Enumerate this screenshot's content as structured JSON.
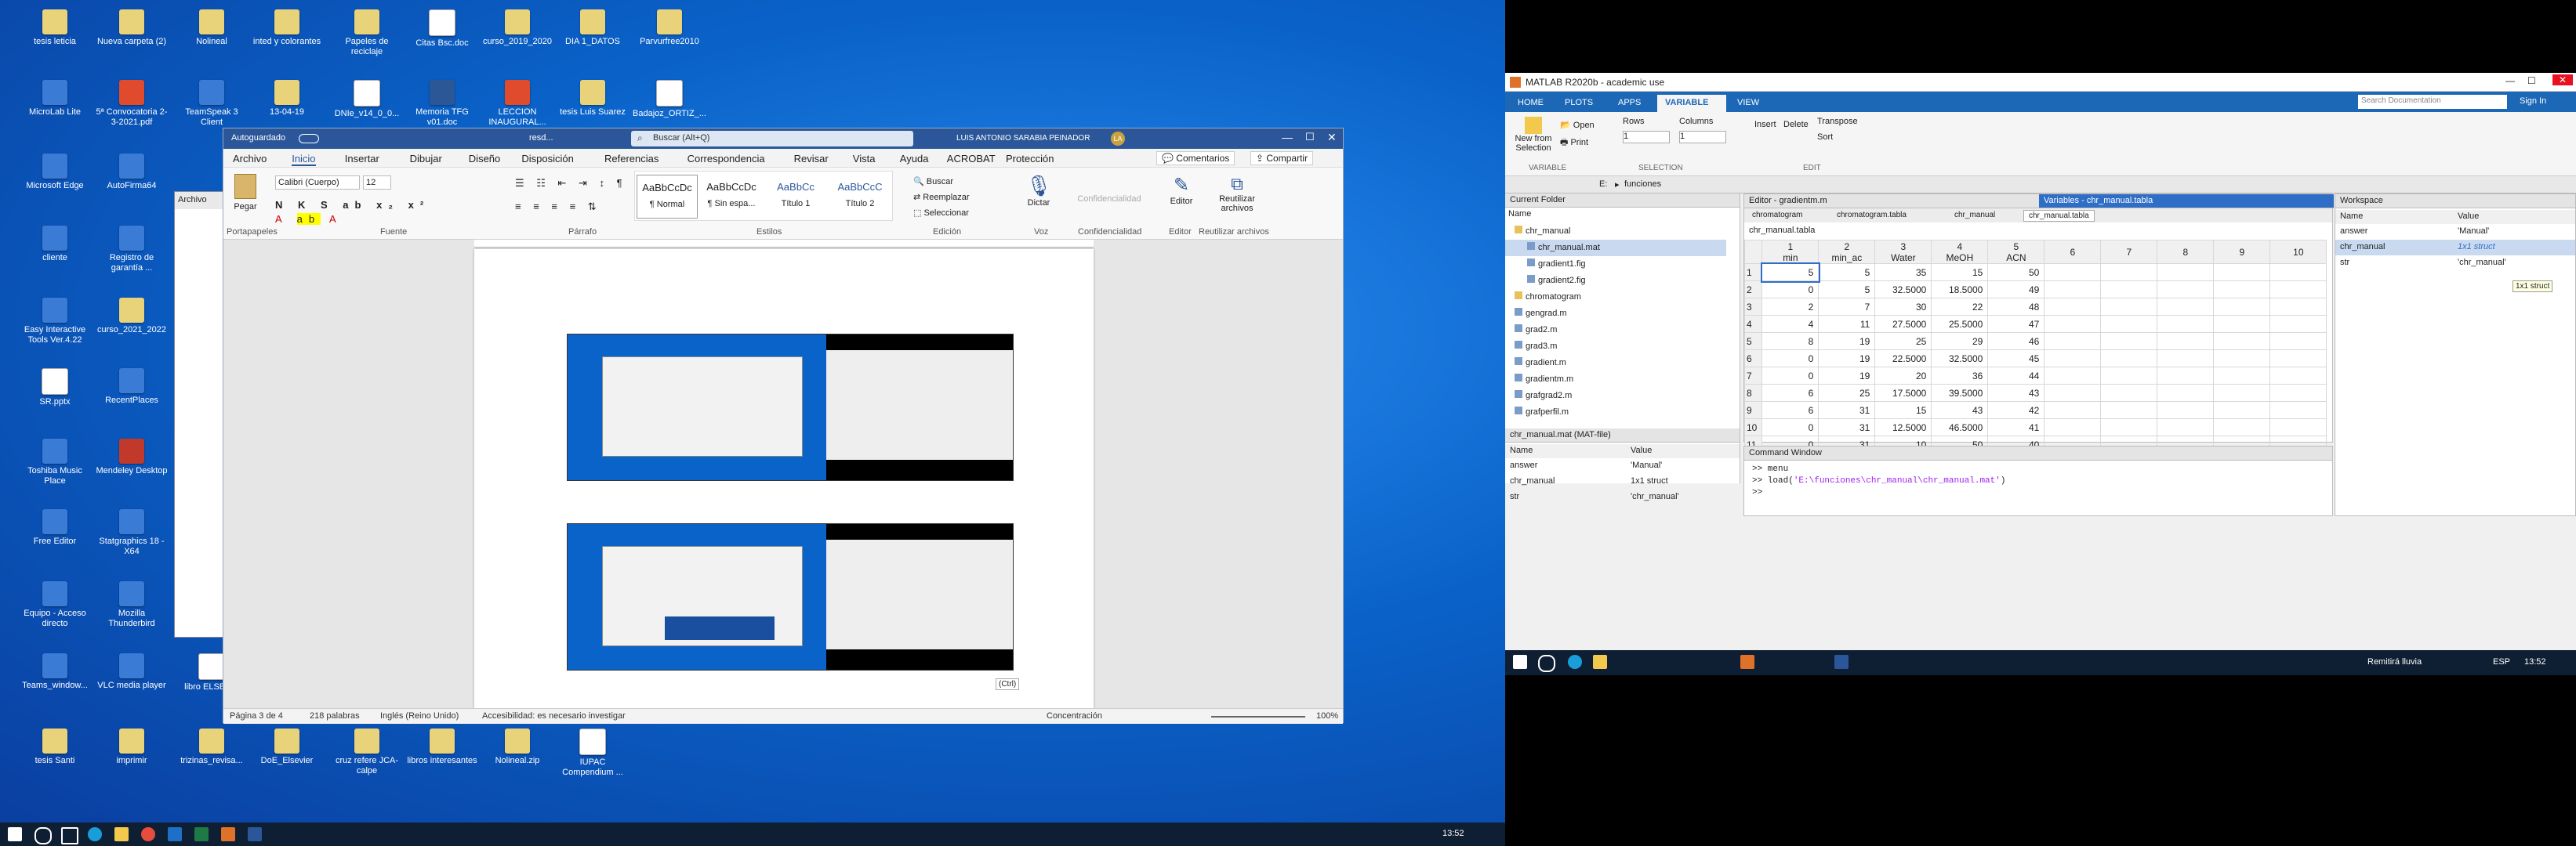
{
  "desktop_icons": [
    {
      "label": "tesis leticia",
      "type": "folder"
    },
    {
      "label": "Nueva carpeta (2)",
      "type": "folder"
    },
    {
      "label": "Nolineal",
      "type": "folder"
    },
    {
      "label": "inted y colorantes",
      "type": "folder"
    },
    {
      "label": "Papeles de reciclaje",
      "type": "folder"
    },
    {
      "label": "Citas Bsc.doc",
      "type": "doc"
    },
    {
      "label": "curso_2019_2020",
      "type": "folder"
    },
    {
      "label": "DIA 1_DATOS",
      "type": "folder"
    },
    {
      "label": "Parvurfree2010",
      "type": "folder"
    },
    {
      "label": "MicroLab Lite",
      "type": "app"
    },
    {
      "label": "5ª Convocatoria 2-3-2021.pdf",
      "type": "pdf"
    },
    {
      "label": "TeamSpeak 3 Client",
      "type": "app"
    },
    {
      "label": "13-04-19",
      "type": "folder"
    },
    {
      "label": "DNIe_v14_0_0...",
      "type": "doc"
    },
    {
      "label": "Memoria TFG v01.doc",
      "type": "word"
    },
    {
      "label": "LECCION INAUGURAL...",
      "type": "pdf"
    },
    {
      "label": "tesis Luis Suarez",
      "type": "folder"
    },
    {
      "label": "Badajoz_ORTIZ_...",
      "type": "doc"
    },
    {
      "label": "Microsoft Edge",
      "type": "app"
    },
    {
      "label": "AutoFirma64",
      "type": "app"
    },
    {
      "label": "cliente",
      "type": "app"
    },
    {
      "label": "Registro de garantía ...",
      "type": "app"
    },
    {
      "label": "Easy Interactive Tools Ver.4.22",
      "type": "app"
    },
    {
      "label": "curso_2021_2022",
      "type": "folder"
    },
    {
      "label": "SR.pptx",
      "type": "doc"
    },
    {
      "label": "RecentPlaces",
      "type": "app"
    },
    {
      "label": "Toshiba Music Place",
      "type": "app"
    },
    {
      "label": "Mendeley Desktop",
      "type": "red"
    },
    {
      "label": "Free Editor",
      "type": "app"
    },
    {
      "label": "Statgraphics 18 - X64",
      "type": "app"
    },
    {
      "label": "Equipo - Acceso directo",
      "type": "app"
    },
    {
      "label": "Mozilla Thunderbird",
      "type": "app"
    },
    {
      "label": "Teams_window...",
      "type": "app"
    },
    {
      "label": "VLC media player",
      "type": "app"
    },
    {
      "label": "libro ELSEVIE",
      "type": "doc"
    },
    {
      "label": "tesis Santi",
      "type": "folder"
    },
    {
      "label": "imprimir",
      "type": "folder"
    },
    {
      "label": "trizinas_revisa...",
      "type": "folder"
    },
    {
      "label": "DoE_Elsevier",
      "type": "folder"
    },
    {
      "label": "cruz refere JCA-calpe",
      "type": "folder"
    },
    {
      "label": "libros interesantes",
      "type": "folder"
    },
    {
      "label": "Nolineal.zip",
      "type": "folder"
    },
    {
      "label": "IUPAC Compendium ...",
      "type": "doc"
    }
  ],
  "taskbar1": {
    "time": "13:52"
  },
  "word": {
    "autosave": "Autoguardado",
    "doc_name": "resd... ",
    "search_placeholder": "Buscar (Alt+Q)",
    "user": "LUIS ANTONIO SARABIA PEINADOR",
    "user_initials": "LA",
    "menu": [
      "Archivo",
      "Inicio",
      "Insertar",
      "Dibujar",
      "Diseño",
      "Disposición",
      "Referencias",
      "Correspondencia",
      "Revisar",
      "Vista",
      "Ayuda",
      "ACROBAT",
      "Protección"
    ],
    "comments": "Comentarios",
    "share": "Compartir",
    "ribbon": {
      "paste": "Pegar",
      "clipboard": "Portapapeles",
      "font_name": "Calibri (Cuerpo)",
      "font_size": "12",
      "font_group": "Fuente",
      "paragraph_group": "Párrafo",
      "styles": [
        "AaBbCcDc",
        "AaBbCcDc",
        "AaBbCc",
        "AaBbCcC"
      ],
      "style_names": [
        "¶ Normal",
        "¶ Sin espa...",
        "Título 1",
        "Título 2"
      ],
      "styles_group": "Estilos",
      "find": "Buscar",
      "replace": "Reemplazar",
      "select": "Seleccionar",
      "edit_group": "Edición",
      "dictate": "Dictar",
      "voice_group": "Voz",
      "sensitivity": "Confidencialidad",
      "editor": "Editor",
      "reuse": "Reutilizar archivos"
    },
    "ctrl_tag": "(Ctrl)",
    "status": {
      "page": "Página 3 de 4",
      "words": "218 palabras",
      "language": "Inglés (Reino Unido)",
      "accessibility": "Accesibilidad: es necesario investigar",
      "focus": "Concentración",
      "zoom": "100%"
    }
  },
  "matlab": {
    "title": "MATLAB R2020b - academic use",
    "tabs": [
      "HOME",
      "PLOTS",
      "APPS",
      "VARIABLE",
      "VIEW"
    ],
    "search_placeholder": "Search Documentation",
    "sign_in": "Sign In",
    "toolstrip": {
      "new_from_selection": "New from Selection",
      "open": "Open",
      "print": "Print",
      "rows": "Rows",
      "columns": "Columns",
      "rows_val": "1",
      "cols_val": "1",
      "insert": "Insert",
      "delete": "Delete",
      "transpose": "Transpose",
      "sort": "Sort",
      "variable_group": "VARIABLE",
      "selection_group": "SELECTION",
      "edit_group": "EDIT"
    },
    "path": [
      "E:",
      "funciones"
    ],
    "current_folder_title": "Current Folder",
    "name_col": "Name",
    "files": [
      "chr_manual",
      "chr_manual.mat",
      "gradient1.fig",
      "gradient2.fig",
      "chromatogram",
      "gengrad.m",
      "grad2.m",
      "grad3.m",
      "gradient.m",
      "gradientm.m",
      "grafgrad2.m",
      "grafperfil.m"
    ],
    "details_title": "chr_manual.mat (MAT-file)",
    "details_cols": [
      "Name",
      "Value"
    ],
    "details_rows": [
      [
        "answer",
        "'Manual'"
      ],
      [
        "chr_manual",
        "1x1 struct"
      ],
      [
        "str",
        "'chr_manual'"
      ]
    ],
    "editor_title": "Editor - gradientm.m",
    "variables_title": "Variables - chr_manual.tabla",
    "var_tabs": [
      "chromatogram",
      "chromatogram.tabla",
      "chr_manual",
      "chr_manual.tabla"
    ],
    "var_name": "chr_manual.tabla",
    "col_headers": [
      [
        "1",
        "min"
      ],
      [
        "2",
        "min_ac"
      ],
      [
        "3",
        "Water"
      ],
      [
        "4",
        "MeOH"
      ],
      [
        "5",
        "ACN"
      ],
      [
        "6",
        ""
      ],
      [
        "7",
        ""
      ],
      [
        "8",
        ""
      ],
      [
        "9",
        ""
      ],
      [
        "10",
        ""
      ]
    ],
    "rows": [
      [
        "5",
        "5",
        "35",
        "15",
        "50"
      ],
      [
        "0",
        "5",
        "32.5000",
        "18.5000",
        "49"
      ],
      [
        "2",
        "7",
        "30",
        "22",
        "48"
      ],
      [
        "4",
        "11",
        "27.5000",
        "25.5000",
        "47"
      ],
      [
        "8",
        "19",
        "25",
        "29",
        "46"
      ],
      [
        "0",
        "19",
        "22.5000",
        "32.5000",
        "45"
      ],
      [
        "0",
        "19",
        "20",
        "36",
        "44"
      ],
      [
        "6",
        "25",
        "17.5000",
        "39.5000",
        "43"
      ],
      [
        "6",
        "31",
        "15",
        "43",
        "42"
      ],
      [
        "0",
        "31",
        "12.5000",
        "46.5000",
        "41"
      ],
      [
        "0",
        "31",
        "10",
        "50",
        "40"
      ]
    ],
    "command_window_title": "Command Window",
    "commands": [
      ">> menu",
      ">> load('E:\\funciones\\chr_manual\\chr_manual.mat')",
      ">>"
    ],
    "workspace_title": "Workspace",
    "ws_cols": [
      "Name",
      "Value"
    ],
    "ws_rows": [
      [
        "answer",
        "'Manual'"
      ],
      [
        "chr_manual",
        "1x1 struct"
      ],
      [
        "str",
        "'chr_manual'"
      ]
    ],
    "tooltip": "1x1 struct"
  },
  "taskbar2": {
    "weather": "Remitirá lluvia",
    "lang": "ESP",
    "time": "13:52"
  }
}
